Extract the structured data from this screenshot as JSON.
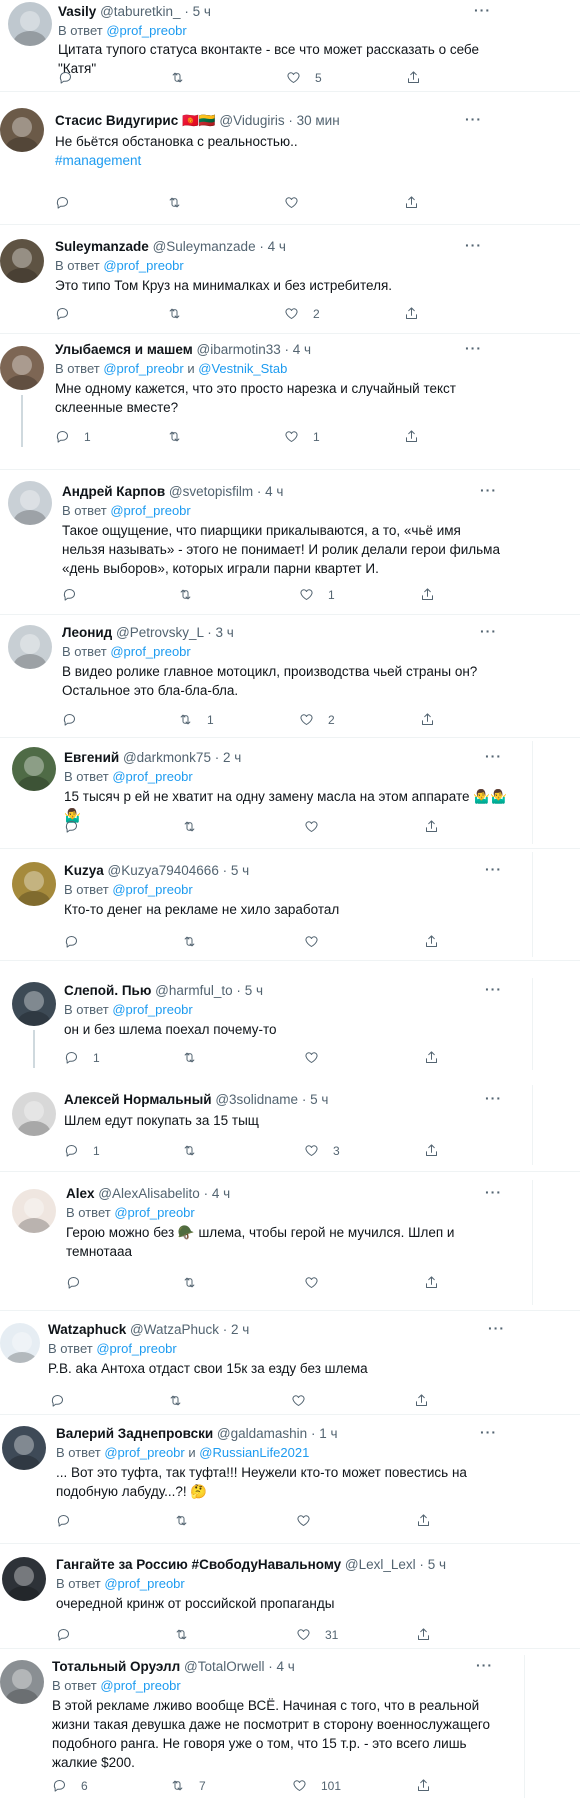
{
  "ui": {
    "more_label": "···",
    "reply_prefix": "В ответ",
    "and_word": "и",
    "dot": "·"
  },
  "tweets": [
    {
      "name": "Vasily",
      "handle": "@taburetkin_",
      "time": "5 ч",
      "replying_to": [
        "@prof_preobr"
      ],
      "text": "Цитата тупого статуса вконтакте - все что может рассказать о себе \"Катя\"",
      "counts": {
        "replies": "",
        "retweets": "",
        "likes": "5"
      }
    },
    {
      "name": "Стасис Видугирис",
      "flags": "🇰🇬🇱🇹",
      "handle": "@Vidugiris",
      "time": "30 мин",
      "replying_to": [],
      "text": "Не бьётся обстановка с реальностью..",
      "hashtag": "#management",
      "counts": {
        "replies": "",
        "retweets": "",
        "likes": ""
      }
    },
    {
      "name": "Suleymanzade",
      "handle": "@Suleymanzade",
      "time": "4 ч",
      "replying_to": [
        "@prof_preobr"
      ],
      "text": "Это типо Том Круз на минималках и без истребителя.",
      "counts": {
        "replies": "",
        "retweets": "",
        "likes": "2"
      }
    },
    {
      "name": "Улыбаемся и машем",
      "handle": "@ibarmotin33",
      "time": "4 ч",
      "replying_to": [
        "@prof_preobr",
        "@Vestnik_Stab"
      ],
      "text": "Мне одному кажется, что это просто нарезка и случайный текст склеенные вместе?",
      "counts": {
        "replies": "1",
        "retweets": "",
        "likes": "1"
      }
    },
    {
      "name": "Андрей Карпов",
      "handle": "@svetopisfilm",
      "time": "4 ч",
      "replying_to": [
        "@prof_preobr"
      ],
      "text": "Такое ощущение, что пиарщики прикалываются, а то, «чьё имя нельзя называть» - этого не понимает! И ролик делали герои фильма «день выборов», которых играли парни квартет И.",
      "counts": {
        "replies": "",
        "retweets": "",
        "likes": "1"
      }
    },
    {
      "name": "Леонид",
      "handle": "@Petrovsky_L",
      "time": "3 ч",
      "replying_to": [
        "@prof_preobr"
      ],
      "text": "В видео ролике главное мотоцикл, производства чьей страны он? Остальное это бла-бла-бла.",
      "counts": {
        "replies": "",
        "retweets": "1",
        "likes": "2"
      }
    },
    {
      "name": "Евгений",
      "handle": "@darkmonk75",
      "time": "2 ч",
      "replying_to": [
        "@prof_preobr"
      ],
      "text": "15 тысяч р ей не хватит на одну замену масла на этом аппарате 🤷‍♂️🤷‍♂️🤷‍♂️",
      "counts": {
        "replies": "",
        "retweets": "",
        "likes": ""
      }
    },
    {
      "name": "Kuzya",
      "handle": "@Kuzya79404666",
      "time": "5 ч",
      "replying_to": [
        "@prof_preobr"
      ],
      "text": "Кто-то денег на рекламе не хило заработал",
      "counts": {
        "replies": "",
        "retweets": "",
        "likes": ""
      }
    },
    {
      "name": "Слепой. Пью",
      "handle": "@harmful_to",
      "time": "5 ч",
      "replying_to": [
        "@prof_preobr"
      ],
      "text": "он и без шлема поехал почему-то",
      "counts": {
        "replies": "1",
        "retweets": "",
        "likes": ""
      }
    },
    {
      "name": "Алексей Нормальный",
      "handle": "@3solidname",
      "time": "5 ч",
      "replying_to": [],
      "text": "Шлем едут покупать за 15 тыщ",
      "counts": {
        "replies": "1",
        "retweets": "",
        "likes": "3"
      }
    },
    {
      "name": "Alex",
      "handle": "@AlexAlisabelito",
      "time": "4 ч",
      "replying_to": [
        "@prof_preobr"
      ],
      "text": "Герою можно без 🪖 шлема, чтобы герой не мучился. Шлеп и темнотааа",
      "counts": {
        "replies": "",
        "retweets": "",
        "likes": ""
      }
    },
    {
      "name": "Watzaphuck",
      "handle": "@WatzaPhuck",
      "time": "2 ч",
      "replying_to": [
        "@prof_preobr"
      ],
      "text": "P.B. aka Антоха отдаст свои 15к за езду без шлема",
      "counts": {
        "replies": "",
        "retweets": "",
        "likes": ""
      }
    },
    {
      "name": "Валерий Заднепровски",
      "handle": "@galdamashin",
      "time": "1 ч",
      "replying_to": [
        "@prof_preobr",
        "@RussianLife2021"
      ],
      "text": "... Вот это туфта, так туфта!!! Неужели кто-то может повестись на подобную лабуду...?! 🤔",
      "counts": {
        "replies": "",
        "retweets": "",
        "likes": ""
      }
    },
    {
      "name": "Гангайте за Россию #СвободуНавальному",
      "handle": "@Lexl_Lexl",
      "time": "5 ч",
      "replying_to": [
        "@prof_preobr"
      ],
      "text": "очередной кринж от российской пропаганды",
      "counts": {
        "replies": "",
        "retweets": "",
        "likes": "31"
      }
    },
    {
      "name": "Тотальный Оруэлл",
      "handle": "@TotalOrwell",
      "time": "4 ч",
      "replying_to": [
        "@prof_preobr"
      ],
      "text": "В этой рекламе лживо вообще ВСЁ. Начиная с того, что в реальной жизни такая девушка даже не посмотрит в сторону военнослужащего подобного ранга. Не говоря уже о том, что 15 т.р. - это всего лишь жалкие $200.",
      "counts": {
        "replies": "6",
        "retweets": "7",
        "likes": "101"
      }
    }
  ]
}
